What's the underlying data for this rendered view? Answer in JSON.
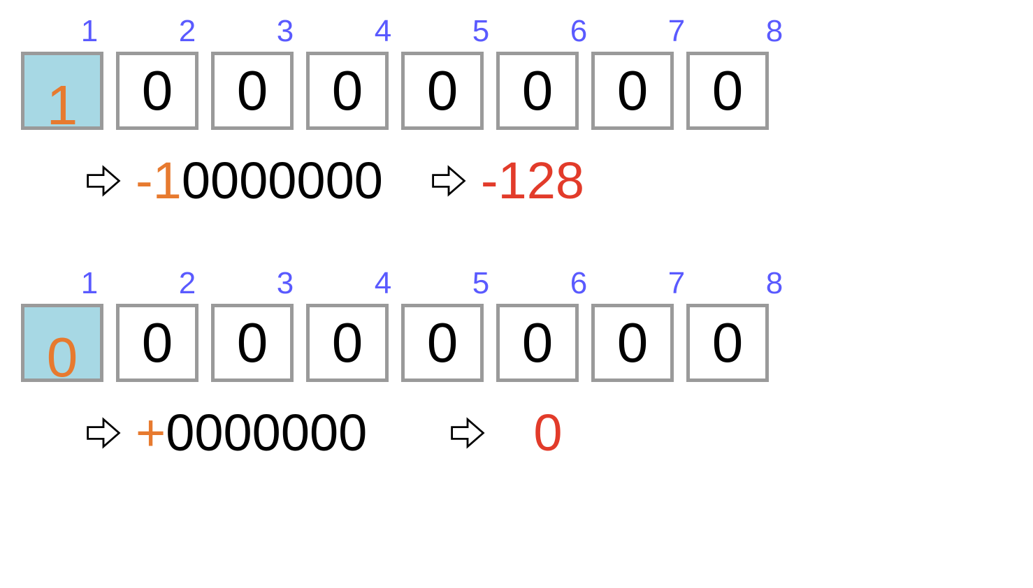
{
  "rows": [
    {
      "positions": [
        "1",
        "2",
        "3",
        "4",
        "5",
        "6",
        "7",
        "8"
      ],
      "bits": [
        "1",
        "0",
        "0",
        "0",
        "0",
        "0",
        "0",
        "0"
      ],
      "signChar": "-",
      "signDigit": "1",
      "magnitude": "0000000",
      "decimal": "-128"
    },
    {
      "positions": [
        "1",
        "2",
        "3",
        "4",
        "5",
        "6",
        "7",
        "8"
      ],
      "bits": [
        "0",
        "0",
        "0",
        "0",
        "0",
        "0",
        "0",
        "0"
      ],
      "signChar": "+",
      "signDigit": "",
      "magnitude": "0000000",
      "decimal": "0"
    }
  ]
}
